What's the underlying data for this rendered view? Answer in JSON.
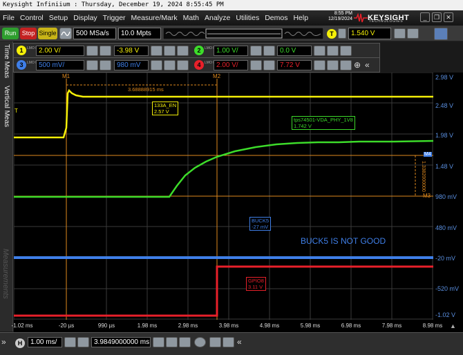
{
  "window": {
    "title": "Keysight Infiniium : Thursday, December 19, 2024 8:55:45 PM"
  },
  "menu": [
    "File",
    "Control",
    "Setup",
    "Display",
    "Trigger",
    "Measure/Mark",
    "Math",
    "Analyze",
    "Utilities",
    "Demos",
    "Help"
  ],
  "datetime": {
    "time": "8:55 PM",
    "date": "12/19/2024"
  },
  "brand": {
    "name": "KEYSIGHT",
    "sub": "TECHNOLOGIES"
  },
  "toolbar": {
    "run": "Run",
    "stop": "Stop",
    "single": "Single",
    "sample_rate": "500 MSa/s",
    "memory_depth": "10.0 Mpts",
    "trigger_level": "1.540 V"
  },
  "channels": [
    {
      "num": "1",
      "coupling": "LMO DC",
      "scale": "2.00 V/",
      "offset": "-3.98 V",
      "color": "#f5f008"
    },
    {
      "num": "2",
      "coupling": "LMO DC",
      "scale": "1.00 V/",
      "offset": "0.0 V",
      "color": "#3ddc2a"
    },
    {
      "num": "3",
      "coupling": "LMO DC",
      "scale": "500 mV/",
      "offset": "980 mV",
      "color": "#3f7fe8"
    },
    {
      "num": "4",
      "coupling": "LMO DC",
      "scale": "2.00 V/",
      "offset": "7.72 V",
      "color": "#e8202a"
    }
  ],
  "sidebar": {
    "time_meas": "Time Meas",
    "vertical_meas": "Vertical Meas",
    "measurements": "Measurements"
  },
  "plot": {
    "markers": {
      "m1": "M1",
      "m2": "M2",
      "m3": "M3",
      "m4": "M4"
    },
    "delta_time": "3.68888915 ms",
    "delta_volt": "1.3382000000",
    "trigger_marker": "T",
    "annotations": {
      "ch1": {
        "name": "133A_EN",
        "value": "2.57 V"
      },
      "ch2": {
        "name": "tps74501-VDA_PHY_1V8",
        "value": "1.742 V"
      },
      "ch3": {
        "name": "BUCK5",
        "value": "-27 mV"
      },
      "ch4": {
        "name": "GPIO8",
        "value": "3.11 V"
      }
    },
    "note": "BUCK5 IS NOT GOOD"
  },
  "y_axis": [
    "2.98 V",
    "2.48 V",
    "1.98 V",
    "1.48 V",
    "980 mV",
    "480 mV",
    "-20 mV",
    "-520 mV",
    "-1.02 V"
  ],
  "x_axis": [
    "-1.02 ms",
    "-20 µs",
    "990 µs",
    "1.98 ms",
    "2.98 ms",
    "3.98 ms",
    "4.98 ms",
    "5.98 ms",
    "6.98 ms",
    "7.98 ms",
    "8.98 ms"
  ],
  "bottom": {
    "h": "H",
    "timebase": "1.00 ms/",
    "position": "3.9849000000 ms"
  }
}
